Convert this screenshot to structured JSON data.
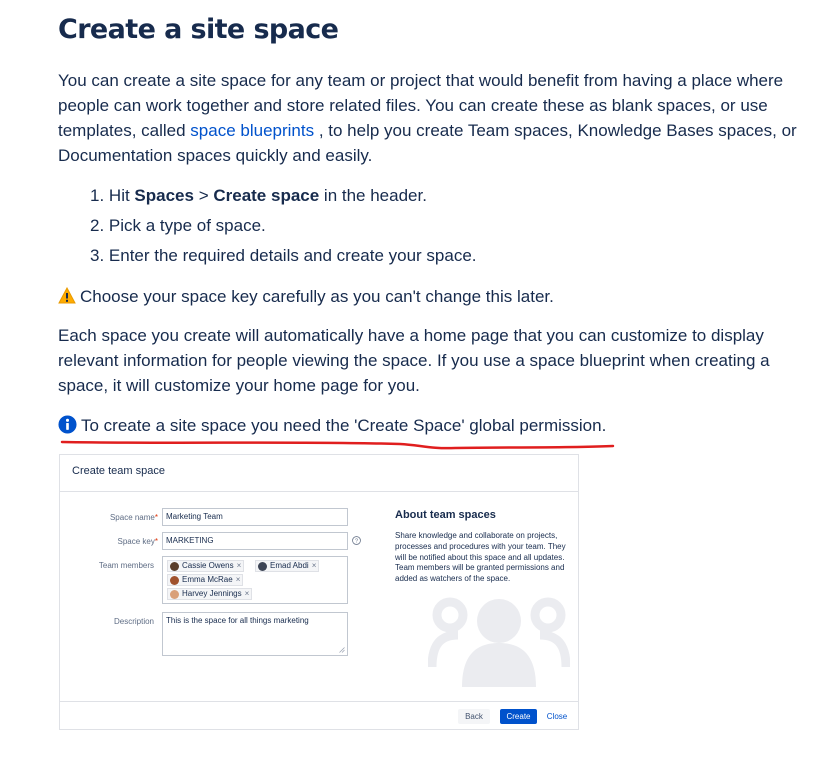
{
  "title": "Create a site space",
  "intro": {
    "before_link": "You can create a site space for any team or project that would benefit from having a place where people can work together and store related files. You can create these as blank spaces, or use templates, called ",
    "link": "space blueprints",
    "after_link": " , to help you create Team spaces, Knowledge Bases spaces, or Documentation spaces quickly and easily."
  },
  "steps": {
    "s1_num": "1.",
    "s1_pre": "Hit ",
    "s1_b1": "Spaces",
    "s1_sep": " > ",
    "s1_b2": "Create space",
    "s1_post": " in the header.",
    "s2": "2. Pick a type of space.",
    "s3": "3. Enter the required details and create your space."
  },
  "warning": "Choose your space key carefully as you can't change this later.",
  "homepage_para": "Each space you create will automatically have a home page that you can customize to display relevant information for people viewing the space. If you use a space blueprint when creating a space, it will customize your home page for you.",
  "info_note": "To create a site space you need the 'Create Space' global permission.",
  "annotation_color": "#e01e1e",
  "dialog": {
    "title": "Create team space",
    "space_name_label": "Space name",
    "space_name_value": "Marketing Team",
    "space_key_label": "Space key",
    "space_key_value": "MARKETING",
    "team_members_label": "Team members",
    "members": [
      "Cassie Owens",
      "Emad Abdi",
      "Emma McRae",
      "Harvey Jennings"
    ],
    "description_label": "Description",
    "description_value": "This is the space for all things marketing",
    "about_title": "About team spaces",
    "about_text": "Share knowledge and collaborate on projects, processes and procedures with your team. They will be notified about this space and all updates. Team members will be granted permissions and added as watchers of the space.",
    "back_label": "Back",
    "create_label": "Create",
    "close_label": "Close"
  }
}
